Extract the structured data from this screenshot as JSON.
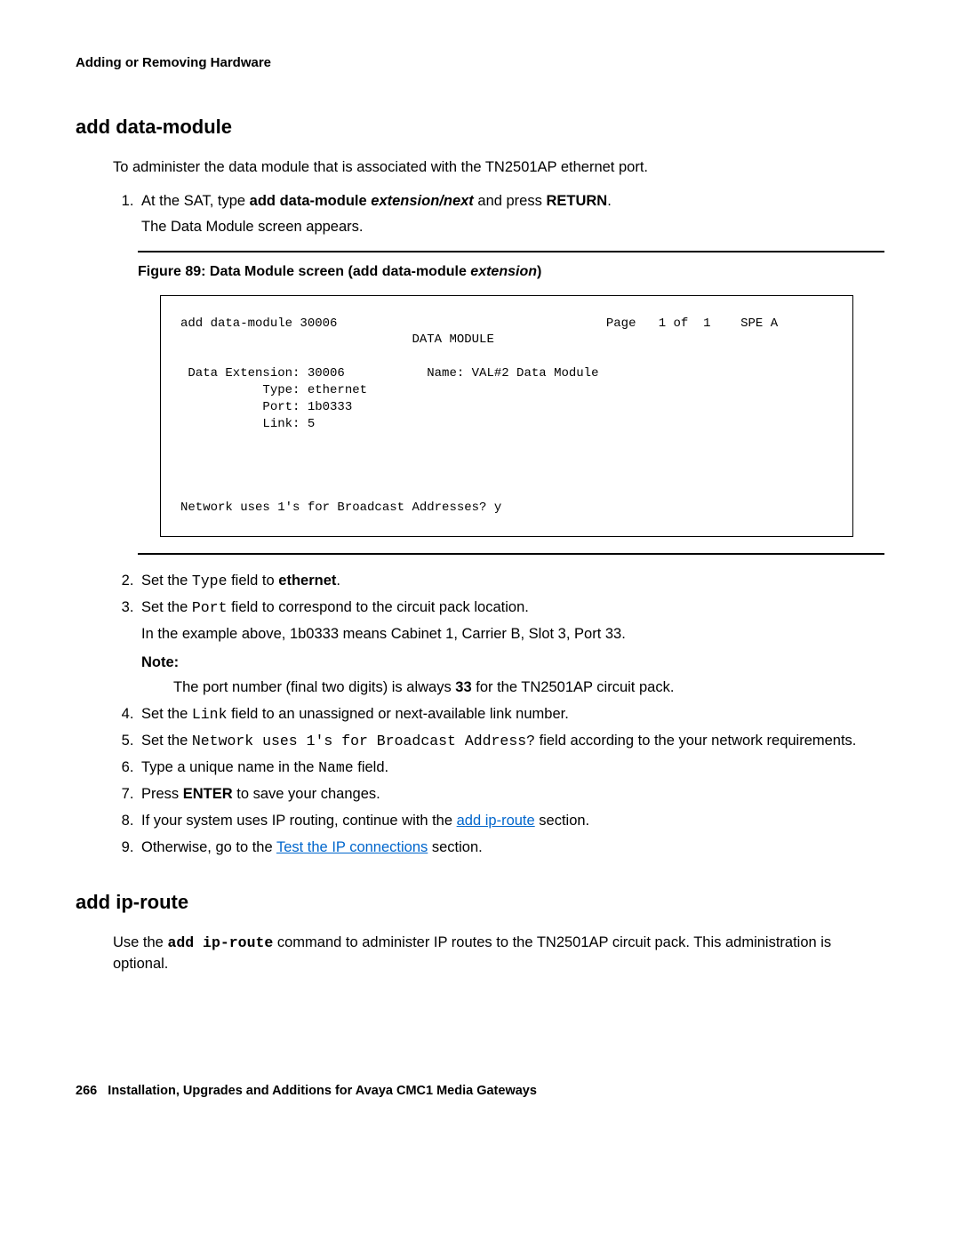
{
  "header": {
    "running": "Adding or Removing Hardware"
  },
  "section1": {
    "title": "add data-module",
    "intro": "To administer the data module that is associated with the TN2501AP ethernet port.",
    "step1_pre": "At the SAT, type ",
    "step1_cmd": "add data-module ",
    "step1_arg": "extension/next",
    "step1_mid": " and press ",
    "step1_key": "RETURN",
    "step1_post": ".",
    "step1_sub": "The Data Module screen appears.",
    "figure_caption_pre": "Figure 89: Data Module screen (add data-module ",
    "figure_caption_arg": "extension",
    "figure_caption_post": ")",
    "terminal": {
      "line1": "add data-module 30006                                    Page   1 of  1    SPE A",
      "line2": "                               DATA MODULE",
      "line3": "",
      "line4": " Data Extension: 30006           Name: VAL#2 Data Module",
      "line5": "           Type: ethernet",
      "line6": "           Port: 1b0333",
      "line7": "           Link: 5",
      "line8": "",
      "line9": "",
      "line10": "",
      "line11": "",
      "line12": "Network uses 1's for Broadcast Addresses? y"
    },
    "step2_pre": "Set the ",
    "step2_field": "Type",
    "step2_mid": " field to ",
    "step2_val": "ethernet",
    "step2_post": ".",
    "step3_pre": "Set the ",
    "step3_field": "Port",
    "step3_post": " field to correspond to the circuit pack location.",
    "step3_sub": "In the example above, 1b0333 means Cabinet 1, Carrier B, Slot 3, Port 33.",
    "note_label": "Note:",
    "note_pre": "The port number (final two digits) is always ",
    "note_bold": "33",
    "note_post": " for the TN2501AP circuit pack.",
    "step4_pre": "Set the ",
    "step4_field": "Link",
    "step4_post": " field to an unassigned or next-available link number.",
    "step5_pre": "Set the ",
    "step5_field": "Network uses 1's for Broadcast Address?",
    "step5_post": " field according to the your network requirements.",
    "step6_pre": "Type a unique name in the ",
    "step6_field": "Name",
    "step6_post": " field.",
    "step7_pre": "Press ",
    "step7_key": "ENTER",
    "step7_post": " to save your changes.",
    "step8_pre": "If your system uses IP routing, continue with the ",
    "step8_link": "add ip-route",
    "step8_post": " section.",
    "step9_pre": "Otherwise, go to the ",
    "step9_link": "Test the IP connections",
    "step9_post": " section."
  },
  "section2": {
    "title": "add ip-route",
    "body_pre": "Use the ",
    "body_cmd": "add ip-route",
    "body_post": " command to administer IP routes to the TN2501AP circuit pack. This administration is optional."
  },
  "footer": {
    "page": "266",
    "title": "Installation, Upgrades and Additions for Avaya CMC1 Media Gateways"
  }
}
